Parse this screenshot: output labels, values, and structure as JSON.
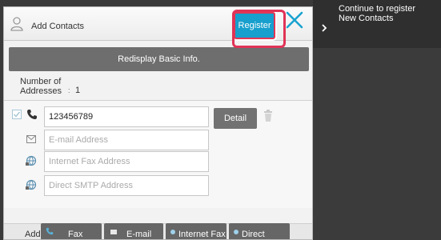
{
  "header": {
    "title": "Add Contacts",
    "register_label": "Register"
  },
  "redisplay_label": "Redisplay Basic Info.",
  "number_of_addresses": {
    "label_line1": "Number of",
    "label_line2": "Addresses",
    "colon": ":",
    "value": "1"
  },
  "fields": {
    "fax_value": "123456789",
    "email_placeholder": "E-mail Address",
    "internet_fax_placeholder": "Internet Fax Address",
    "smtp_placeholder": "Direct SMTP Address"
  },
  "detail_label": "Detail",
  "add_bar": {
    "label": "Add",
    "buttons": [
      "Fax",
      "E-mail",
      "Internet Fax",
      "Direct SMTP"
    ]
  },
  "side": {
    "line1": "Continue to register",
    "line2": "New Contacts"
  },
  "colors": {
    "accent": "#179fcd",
    "highlight": "#e03356",
    "panel": "#f2f2f2",
    "dark": "#3a3a3a"
  }
}
